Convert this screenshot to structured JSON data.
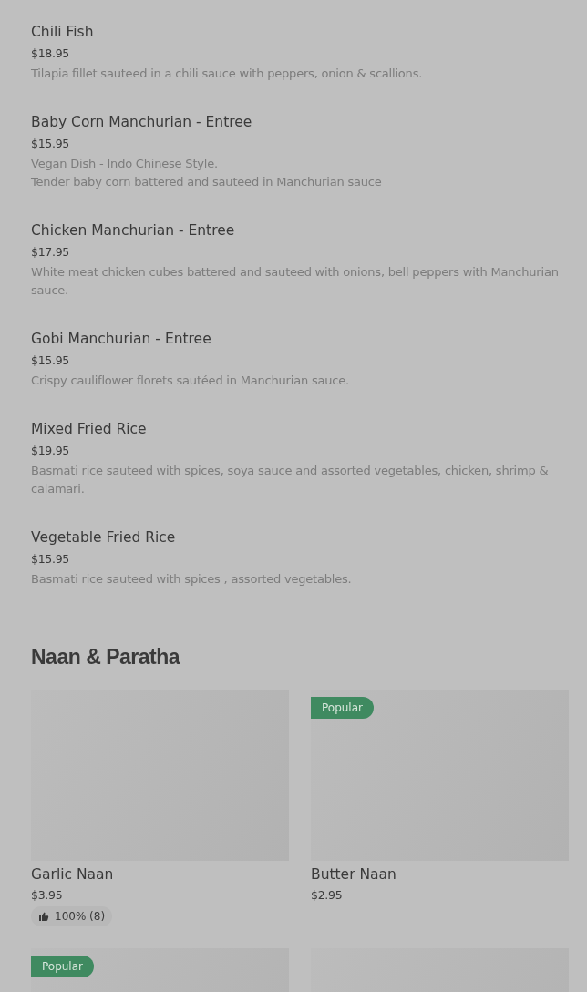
{
  "items": [
    {
      "name": "Chili Fish",
      "price": "$18.95",
      "description": "Tilapia fillet sauteed in a chili sauce with peppers, onion & scallions."
    },
    {
      "name": "Baby Corn Manchurian - Entree",
      "price": "$15.95",
      "description": "Vegan Dish - Indo Chinese Style.\nTender baby corn battered and sauteed in Manchurian sauce"
    },
    {
      "name": "Chicken Manchurian - Entree",
      "price": "$17.95",
      "description": "White meat chicken cubes battered and sauteed with onions, bell peppers with Manchurian sauce."
    },
    {
      "name": "Gobi Manchurian - Entree",
      "price": "$15.95",
      "description": "Crispy cauliflower florets sautéed in Manchurian sauce."
    },
    {
      "name": "Mixed Fried Rice",
      "price": "$19.95",
      "description": "Basmati rice sauteed with spices, soya sauce and assorted vegetables, chicken, shrimp & calamari."
    },
    {
      "name": "Vegetable Fried Rice",
      "price": "$15.95",
      "description": "Basmati rice sauteed with spices , assorted vegetables."
    }
  ],
  "section": {
    "title": "Naan & Paratha",
    "cards": [
      {
        "kind": "image",
        "name": "Garlic Naan",
        "price": "$3.95",
        "rating": "100% (8)"
      },
      {
        "kind": "image",
        "badge": "Popular",
        "name": "Butter Naan",
        "price": "$2.95"
      },
      {
        "kind": "image",
        "badge": "Popular"
      },
      {
        "kind": "image"
      }
    ]
  }
}
